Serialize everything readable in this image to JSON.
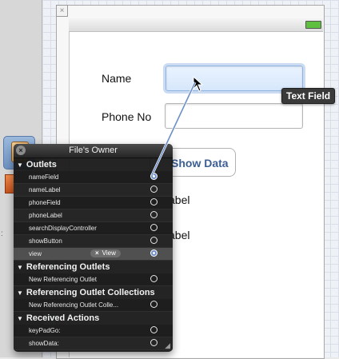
{
  "device": {
    "name_label": "Name",
    "phone_label": "Phone No",
    "show_button_label": "Show Data",
    "label1_fragment": "abel",
    "label2_fragment": "abel"
  },
  "tooltip": {
    "text": "Text Field"
  },
  "hud": {
    "title": "File's Owner",
    "sections": [
      {
        "title": "Outlets",
        "rows": [
          {
            "label": "nameField",
            "connected": true
          },
          {
            "label": "nameLabel",
            "connected": false
          },
          {
            "label": "phoneField",
            "connected": false
          },
          {
            "label": "phoneLabel",
            "connected": false
          },
          {
            "label": "searchDisplayController",
            "connected": false
          },
          {
            "label": "showButton",
            "connected": false
          },
          {
            "label": "view",
            "connected": true,
            "connection_label": "View"
          }
        ]
      },
      {
        "title": "Referencing Outlets",
        "rows": [
          {
            "label": "New Referencing Outlet",
            "connected": false
          }
        ]
      },
      {
        "title": "Referencing Outlet Collections",
        "rows": [
          {
            "label": "New Referencing Outlet Colle...",
            "connected": false
          }
        ]
      },
      {
        "title": "Received Actions",
        "rows": [
          {
            "label": "keyPadGo:",
            "connected": false
          },
          {
            "label": "showData:",
            "connected": false
          }
        ]
      }
    ]
  },
  "icons": {
    "hud_close": "close-circle-icon",
    "frame_close": "close-icon",
    "battery": "battery-icon",
    "cursor": "pointer-cursor-icon",
    "disconnect": "x-icon",
    "resize": "resize-grip-icon",
    "section_disclosure": "disclosure-triangle-icon",
    "owner": "files-owner-cube-icon"
  },
  "colors": {
    "hud_bg": "#161616",
    "connection_line": "#6d8fc7",
    "button_text": "#3c5f93"
  }
}
